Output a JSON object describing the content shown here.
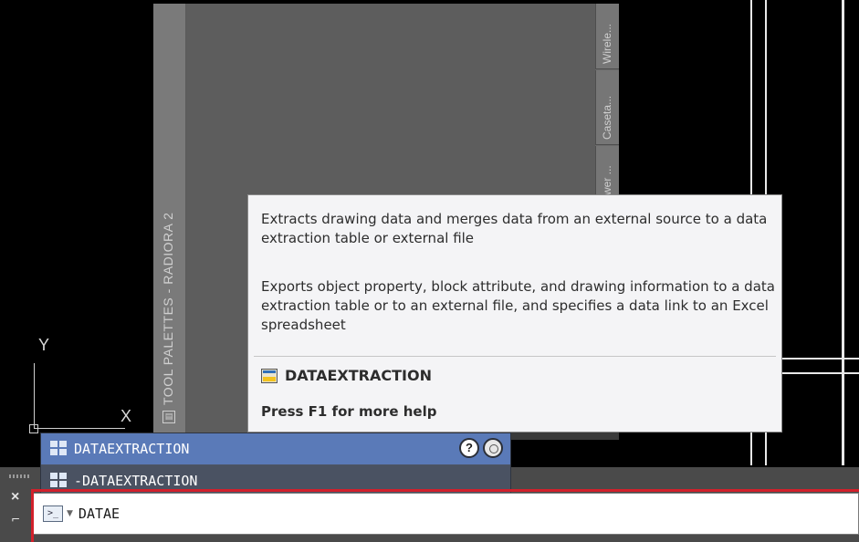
{
  "palette": {
    "title": "TOOL PALETTES - RADIORA 2",
    "tabs": [
      "Wirele...",
      "Caseta...",
      "wer ..."
    ]
  },
  "tooltip": {
    "description_short": "Extracts drawing data and merges data from an external source to a data extraction table or external file",
    "description_long": "Exports object property, block attribute, and drawing information to a data extraction table or to an external file, and specifies a data link to an Excel spreadsheet",
    "command_name": "DATAEXTRACTION",
    "help_hint": "Press F1 for more help"
  },
  "autocomplete": {
    "items": [
      {
        "label": "DATAEXTRACTION",
        "selected": true
      },
      {
        "label": "-DATAEXTRACTION",
        "selected": false
      }
    ],
    "help_button": "?"
  },
  "ucs": {
    "y_label": "Y",
    "x_label": "X"
  },
  "command_line": {
    "prompt_icon": ">_",
    "input_value": "DATAE",
    "close_icon": "×"
  },
  "colors": {
    "background": "#000000",
    "selection": "#5a7ab8",
    "highlight": "#d2202b"
  }
}
